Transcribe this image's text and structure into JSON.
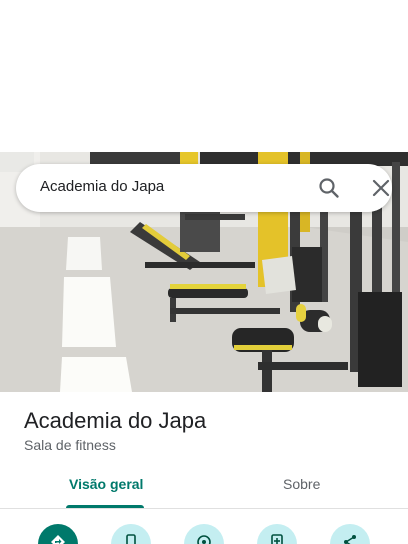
{
  "search": {
    "query": "Academia do Japa"
  },
  "place": {
    "name": "Academia do Japa",
    "category": "Sala de fitness"
  },
  "tabs": [
    {
      "label": "Visão geral",
      "active": true
    },
    {
      "label": "Sobre",
      "active": false
    }
  ],
  "actions": [
    {
      "icon": "directions-icon"
    },
    {
      "icon": "phone-icon"
    },
    {
      "icon": "location-icon"
    },
    {
      "icon": "save-icon"
    },
    {
      "icon": "share-icon"
    }
  ],
  "colors": {
    "accent": "#00796b",
    "action_bg": "#c4eef1",
    "text_primary": "#202124",
    "text_secondary": "#5f6368"
  }
}
